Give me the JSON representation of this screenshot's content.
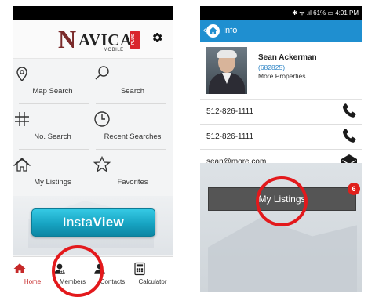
{
  "left": {
    "logo": {
      "n": "N",
      "text": "AVICA",
      "sub": "MOBILE",
      "plus": "PLUS"
    },
    "grid": [
      {
        "label": "Map Search",
        "icon": "map-pin-icon"
      },
      {
        "label": "Search",
        "icon": "magnifier-icon"
      },
      {
        "label": "No. Search",
        "icon": "hash-icon"
      },
      {
        "label": "Recent Searches",
        "icon": "clock-icon"
      },
      {
        "label": "My Listings",
        "icon": "house-icon"
      },
      {
        "label": "Favorites",
        "icon": "star-icon"
      }
    ],
    "insta": {
      "pre": "Insta",
      "bold": "View"
    },
    "tabs": [
      {
        "label": "Home",
        "icon": "home-icon",
        "active": true
      },
      {
        "label": "Members",
        "icon": "members-icon"
      },
      {
        "label": "Contacts",
        "icon": "contacts-icon"
      },
      {
        "label": "Calculator",
        "icon": "calculator-icon"
      }
    ],
    "accent": "#c62828"
  },
  "right": {
    "status": "✱ ᯤ .ıl 61% ▭ 4:01 PM",
    "back_label": "Info",
    "agent": {
      "name": "Sean Ackerman",
      "id": "(682825)",
      "more": "More Properties"
    },
    "rows": [
      {
        "text": "512-826-1111",
        "icon": "phone-icon"
      },
      {
        "text": "512-826-1111",
        "icon": "phone-icon"
      },
      {
        "text": "sean@more.com",
        "icon": "envelope-icon"
      }
    ],
    "listings_button": "My Listings",
    "badge": "6",
    "header_color": "#1f8fd0"
  }
}
